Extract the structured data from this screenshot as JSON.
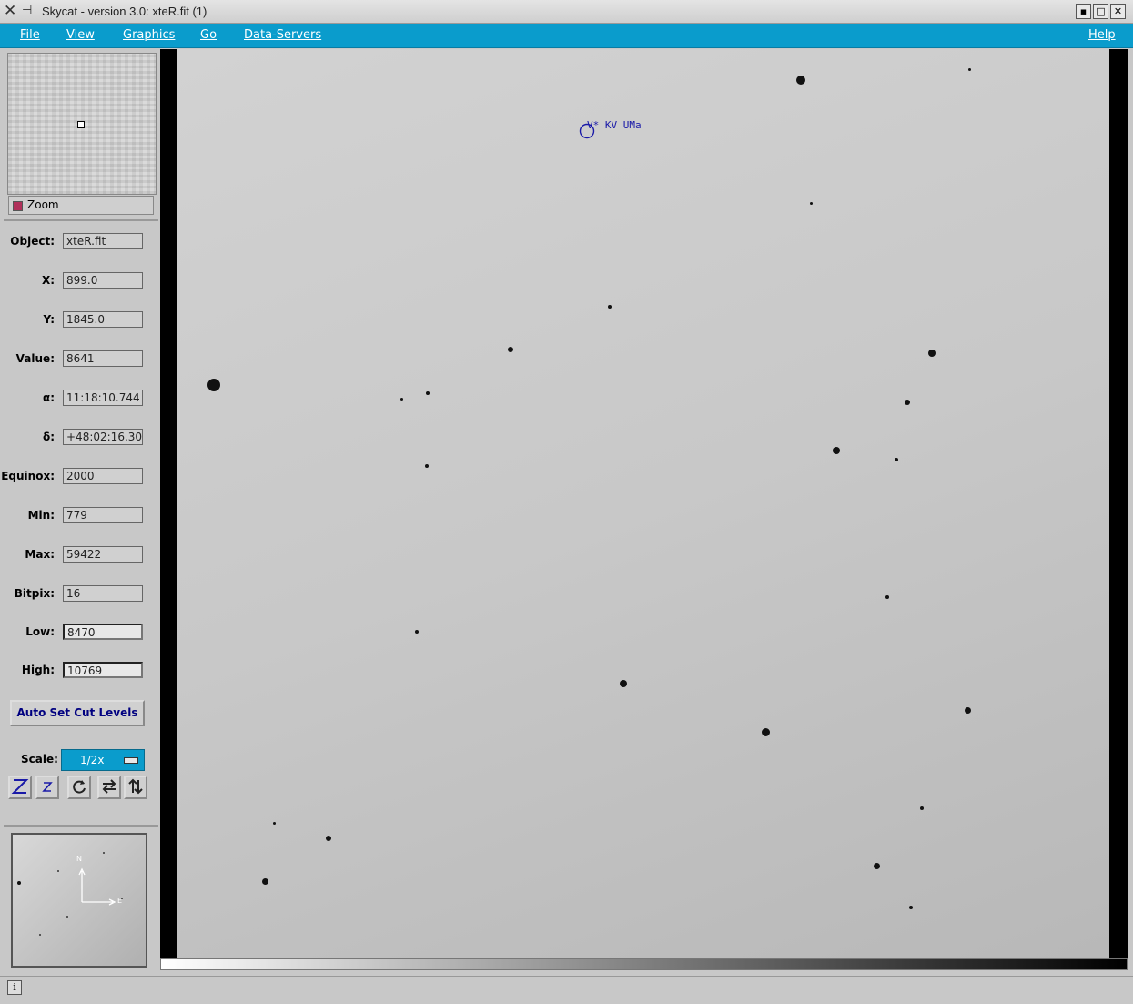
{
  "window": {
    "title": "Skycat - version 3.0: xteR.fit (1)"
  },
  "menu": {
    "file": "File",
    "view": "View",
    "graphics": "Graphics",
    "go": "Go",
    "data_servers": "Data-Servers",
    "help": "Help"
  },
  "zoom": {
    "label": "Zoom"
  },
  "info": {
    "object_label": "Object:",
    "object": "xteR.fit",
    "x_label": "X:",
    "x": "899.0",
    "y_label": "Y:",
    "y": "1845.0",
    "value_label": "Value:",
    "value": "8641",
    "alpha_label": "α:",
    "alpha": "11:18:10.744",
    "delta_label": "δ:",
    "delta": "+48:02:16.30",
    "equinox_label": "Equinox:",
    "equinox": "2000",
    "min_label": "Min:",
    "min": "779",
    "max_label": "Max:",
    "max": "59422",
    "bitpix_label": "Bitpix:",
    "bitpix": "16",
    "low_label": "Low:",
    "low": "8470",
    "high_label": "High:",
    "high": "10769"
  },
  "controls": {
    "auto_cut": "Auto Set Cut Levels",
    "scale_label": "Scale:",
    "scale_value": "1/2x"
  },
  "pan": {
    "north": "N",
    "east": "E"
  },
  "image": {
    "object_label": "V* KV UMa"
  },
  "status": {
    "info_icon": "i"
  }
}
